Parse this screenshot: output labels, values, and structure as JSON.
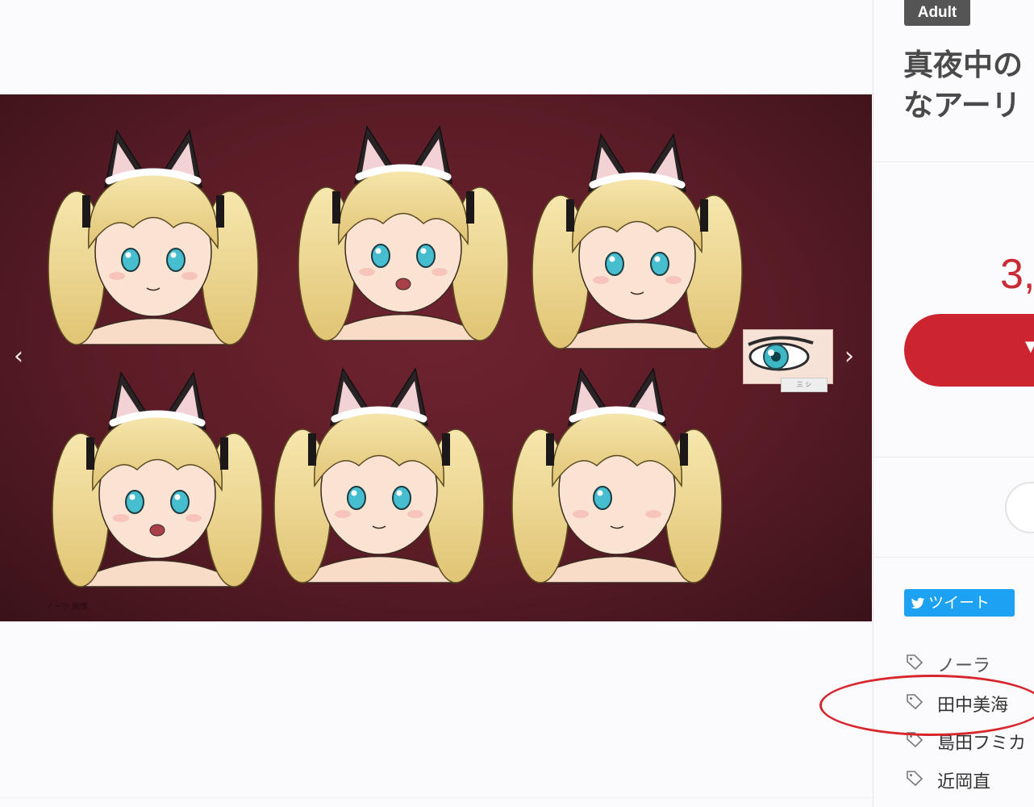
{
  "product": {
    "badge": "Adult",
    "title_line1": "真夜中の",
    "title_line2": "なアーリ",
    "price_partial": "3,"
  },
  "gallery": {
    "prev_icon": "chevron-left-icon",
    "next_icon": "chevron-right-icon",
    "credit": "ノーラ 胸像",
    "thumb_label": "三 シ",
    "background_color": "#5a1c26"
  },
  "share": {
    "tweet_label": "ツイート",
    "icon": "twitter-bird-icon"
  },
  "tags": [
    {
      "label": "ノーラ",
      "icon": "tag-icon"
    },
    {
      "label": "田中美海",
      "icon": "tag-icon"
    },
    {
      "label": "島田フミカ",
      "icon": "tag-icon"
    },
    {
      "label": "近岡直",
      "icon": "tag-icon"
    }
  ],
  "colors": {
    "accent_red": "#cc2530",
    "twitter_blue": "#1da1f2",
    "annotation_red": "#d7262d"
  }
}
